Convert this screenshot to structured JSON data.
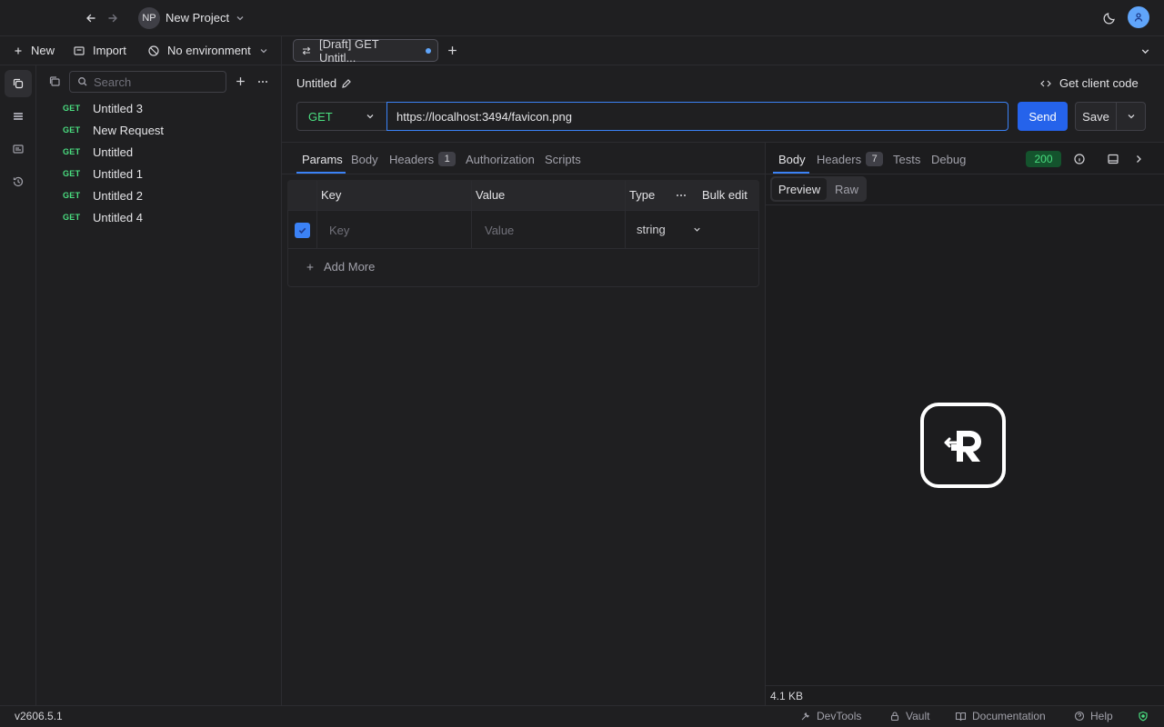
{
  "header": {
    "project_initials": "NP",
    "project_name": "New Project"
  },
  "toolbar": {
    "new_label": "New",
    "import_label": "Import",
    "environment_label": "No environment"
  },
  "tabs": [
    {
      "label": "[Draft] GET Untitl...",
      "unsaved": true
    }
  ],
  "sidebar": {
    "search_placeholder": "Search",
    "requests": [
      {
        "method": "GET",
        "name": "Untitled 3"
      },
      {
        "method": "GET",
        "name": "New Request"
      },
      {
        "method": "GET",
        "name": "Untitled"
      },
      {
        "method": "GET",
        "name": "Untitled 1"
      },
      {
        "method": "GET",
        "name": "Untitled 2"
      },
      {
        "method": "GET",
        "name": "Untitled 4"
      }
    ]
  },
  "request": {
    "title": "Untitled",
    "client_code_label": "Get client code",
    "method": "GET",
    "url": "https://localhost:3494/favicon.png",
    "send_label": "Send",
    "save_label": "Save",
    "tabs": {
      "params": "Params",
      "body": "Body",
      "headers": "Headers",
      "headers_count": "1",
      "authorization": "Authorization",
      "scripts": "Scripts"
    },
    "params_table": {
      "col_key": "Key",
      "col_value": "Value",
      "col_type": "Type",
      "bulk_edit": "Bulk edit",
      "row_key_placeholder": "Key",
      "row_value_placeholder": "Value",
      "row_type": "string",
      "row_checked": true,
      "add_more": "Add More"
    }
  },
  "response": {
    "tabs": {
      "body": "Body",
      "headers": "Headers",
      "headers_count": "7",
      "tests": "Tests",
      "debug": "Debug"
    },
    "status_code": "200",
    "view_preview": "Preview",
    "view_raw": "Raw",
    "size": "4.1 KB"
  },
  "statusbar": {
    "version": "v2606.5.1",
    "devtools": "DevTools",
    "vault": "Vault",
    "documentation": "Documentation",
    "help": "Help"
  },
  "colors": {
    "accent": "#2563eb",
    "method_get": "#4ade80",
    "status_ok_bg": "#14532d"
  }
}
